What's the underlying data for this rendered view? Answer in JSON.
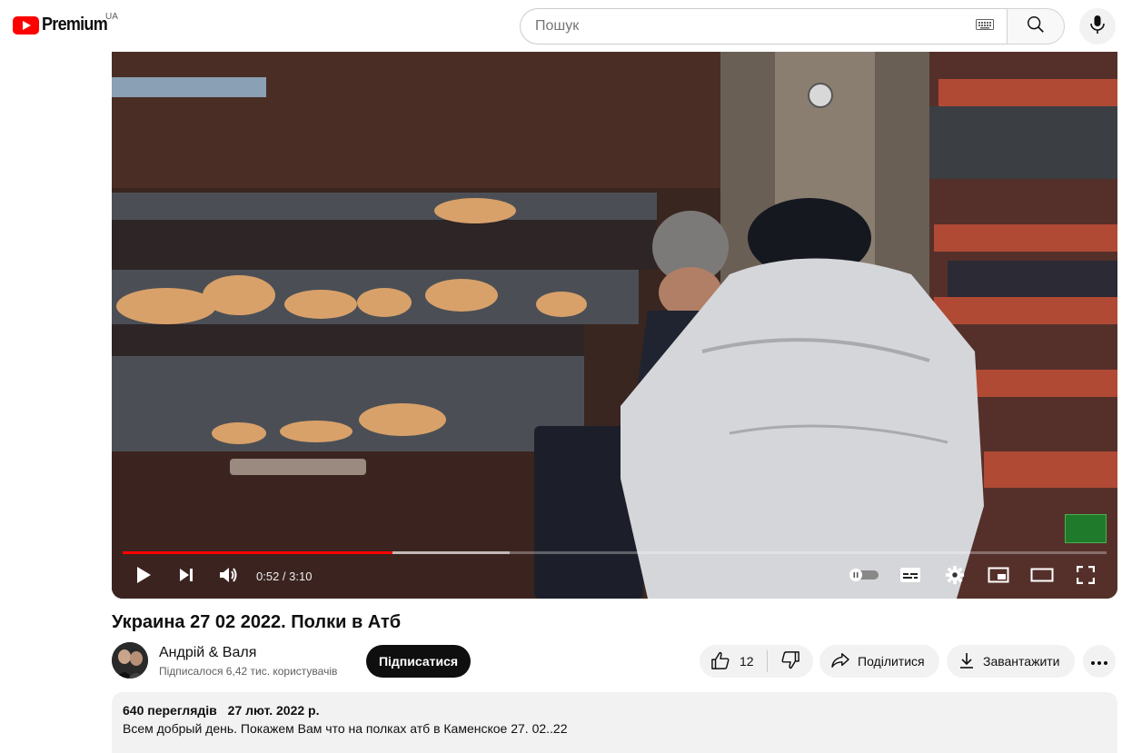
{
  "masthead": {
    "logo_text": "Premium",
    "region": "UA",
    "search_placeholder": "Пошук"
  },
  "player": {
    "time_current": "0:52",
    "time_total": "3:10",
    "time_display": "0:52 / 3:10",
    "progress_played_fraction": 0.274,
    "progress_loaded_fraction": 0.393,
    "accent_color": "#ff0000"
  },
  "video": {
    "title": "Украина 27 02 2022. Полки в Атб"
  },
  "owner": {
    "channel_name": "Андрій & Валя",
    "subscribers": "Підписалося 6,42 тис. користувачів",
    "subscribe_label": "Підписатися"
  },
  "actions": {
    "like_count": "12",
    "share_label": "Поділитися",
    "download_label": "Завантажити"
  },
  "description": {
    "views": "640 переглядів",
    "date": "27 лют. 2022 р.",
    "text": "Всем добрый день. Покажем Вам что на полках атб в Каменское 27. 02..22"
  },
  "icons": [
    "youtube-logo-icon",
    "keyboard-icon",
    "search-icon",
    "mic-icon",
    "play-icon",
    "next-icon",
    "volume-icon",
    "autoplay-toggle-icon",
    "subtitles-icon",
    "settings-icon",
    "miniplayer-icon",
    "theater-icon",
    "fullscreen-icon",
    "like-icon",
    "dislike-icon",
    "share-icon",
    "download-icon",
    "more-icon"
  ]
}
